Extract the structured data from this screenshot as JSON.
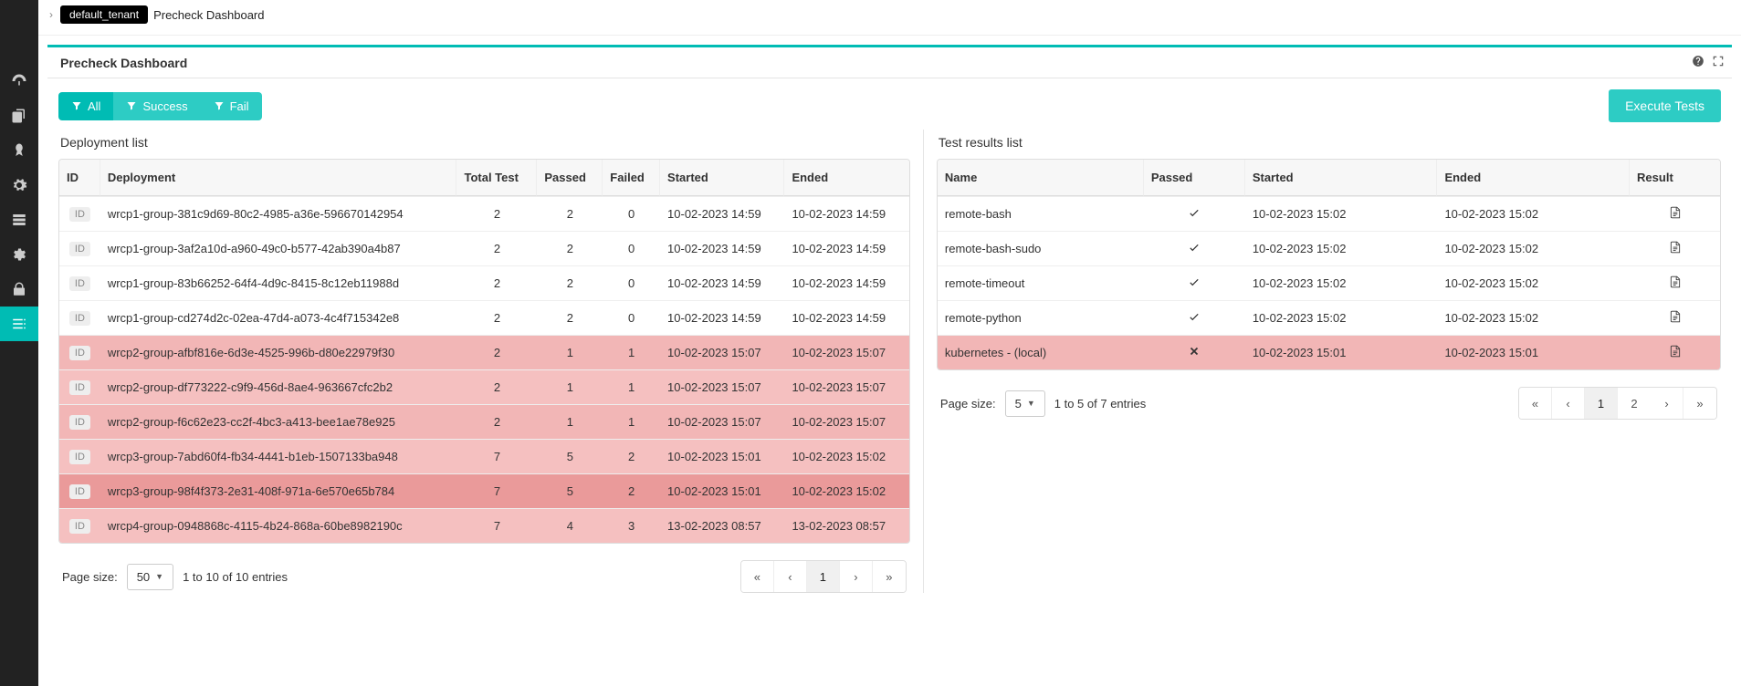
{
  "breadcrumb": {
    "tenant": "default_tenant",
    "title": "Precheck Dashboard"
  },
  "panel": {
    "title": "Precheck Dashboard"
  },
  "filters": {
    "all": "All",
    "success": "Success",
    "fail": "Fail"
  },
  "buttons": {
    "execute": "Execute Tests"
  },
  "left": {
    "title": "Deployment list",
    "headers": {
      "id": "ID",
      "deployment": "Deployment",
      "total": "Total Test",
      "passed": "Passed",
      "failed": "Failed",
      "started": "Started",
      "ended": "Ended"
    },
    "rows": [
      {
        "idbadge": "ID",
        "deployment": "wrcp1-group-381c9d69-80c2-4985-a36e-596670142954",
        "total": "2",
        "passed": "2",
        "failed": "0",
        "started": "10-02-2023 14:59",
        "ended": "10-02-2023 14:59",
        "status": "ok"
      },
      {
        "idbadge": "ID",
        "deployment": "wrcp1-group-3af2a10d-a960-49c0-b577-42ab390a4b87",
        "total": "2",
        "passed": "2",
        "failed": "0",
        "started": "10-02-2023 14:59",
        "ended": "10-02-2023 14:59",
        "status": "ok"
      },
      {
        "idbadge": "ID",
        "deployment": "wrcp1-group-83b66252-64f4-4d9c-8415-8c12eb11988d",
        "total": "2",
        "passed": "2",
        "failed": "0",
        "started": "10-02-2023 14:59",
        "ended": "10-02-2023 14:59",
        "status": "ok"
      },
      {
        "idbadge": "ID",
        "deployment": "wrcp1-group-cd274d2c-02ea-47d4-a073-4c4f715342e8",
        "total": "2",
        "passed": "2",
        "failed": "0",
        "started": "10-02-2023 14:59",
        "ended": "10-02-2023 14:59",
        "status": "ok"
      },
      {
        "idbadge": "ID",
        "deployment": "wrcp2-group-afbf816e-6d3e-4525-996b-d80e22979f30",
        "total": "2",
        "passed": "1",
        "failed": "1",
        "started": "10-02-2023 15:07",
        "ended": "10-02-2023 15:07",
        "status": "fail"
      },
      {
        "idbadge": "ID",
        "deployment": "wrcp2-group-df773222-c9f9-456d-8ae4-963667cfc2b2",
        "total": "2",
        "passed": "1",
        "failed": "1",
        "started": "10-02-2023 15:07",
        "ended": "10-02-2023 15:07",
        "status": "fail"
      },
      {
        "idbadge": "ID",
        "deployment": "wrcp2-group-f6c62e23-cc2f-4bc3-a413-bee1ae78e925",
        "total": "2",
        "passed": "1",
        "failed": "1",
        "started": "10-02-2023 15:07",
        "ended": "10-02-2023 15:07",
        "status": "fail"
      },
      {
        "idbadge": "ID",
        "deployment": "wrcp3-group-7abd60f4-fb34-4441-b1eb-1507133ba948",
        "total": "7",
        "passed": "5",
        "failed": "2",
        "started": "10-02-2023 15:01",
        "ended": "10-02-2023 15:02",
        "status": "fail"
      },
      {
        "idbadge": "ID",
        "deployment": "wrcp3-group-98f4f373-2e31-408f-971a-6e570e65b784",
        "total": "7",
        "passed": "5",
        "failed": "2",
        "started": "10-02-2023 15:01",
        "ended": "10-02-2023 15:02",
        "status": "fail-selected"
      },
      {
        "idbadge": "ID",
        "deployment": "wrcp4-group-0948868c-4115-4b24-868a-60be8982190c",
        "total": "7",
        "passed": "4",
        "failed": "3",
        "started": "13-02-2023 08:57",
        "ended": "13-02-2023 08:57",
        "status": "fail"
      }
    ],
    "page_size_label": "Page size:",
    "page_size_value": "50",
    "entries_text": "1 to 10 of 10 entries",
    "current_page": "1"
  },
  "right": {
    "title": "Test results list",
    "headers": {
      "name": "Name",
      "passed": "Passed",
      "started": "Started",
      "ended": "Ended",
      "result": "Result"
    },
    "rows": [
      {
        "name": "remote-bash",
        "passed": true,
        "started": "10-02-2023 15:02",
        "ended": "10-02-2023 15:02",
        "status": "ok"
      },
      {
        "name": "remote-bash-sudo",
        "passed": true,
        "started": "10-02-2023 15:02",
        "ended": "10-02-2023 15:02",
        "status": "ok"
      },
      {
        "name": "remote-timeout",
        "passed": true,
        "started": "10-02-2023 15:02",
        "ended": "10-02-2023 15:02",
        "status": "ok"
      },
      {
        "name": "remote-python",
        "passed": true,
        "started": "10-02-2023 15:02",
        "ended": "10-02-2023 15:02",
        "status": "ok"
      },
      {
        "name": "kubernetes - (local)",
        "passed": false,
        "started": "10-02-2023 15:01",
        "ended": "10-02-2023 15:01",
        "status": "fail"
      }
    ],
    "page_size_label": "Page size:",
    "page_size_value": "5",
    "entries_text": "1 to 5 of 7 entries",
    "pages": [
      "1",
      "2"
    ],
    "current_page": "1"
  }
}
